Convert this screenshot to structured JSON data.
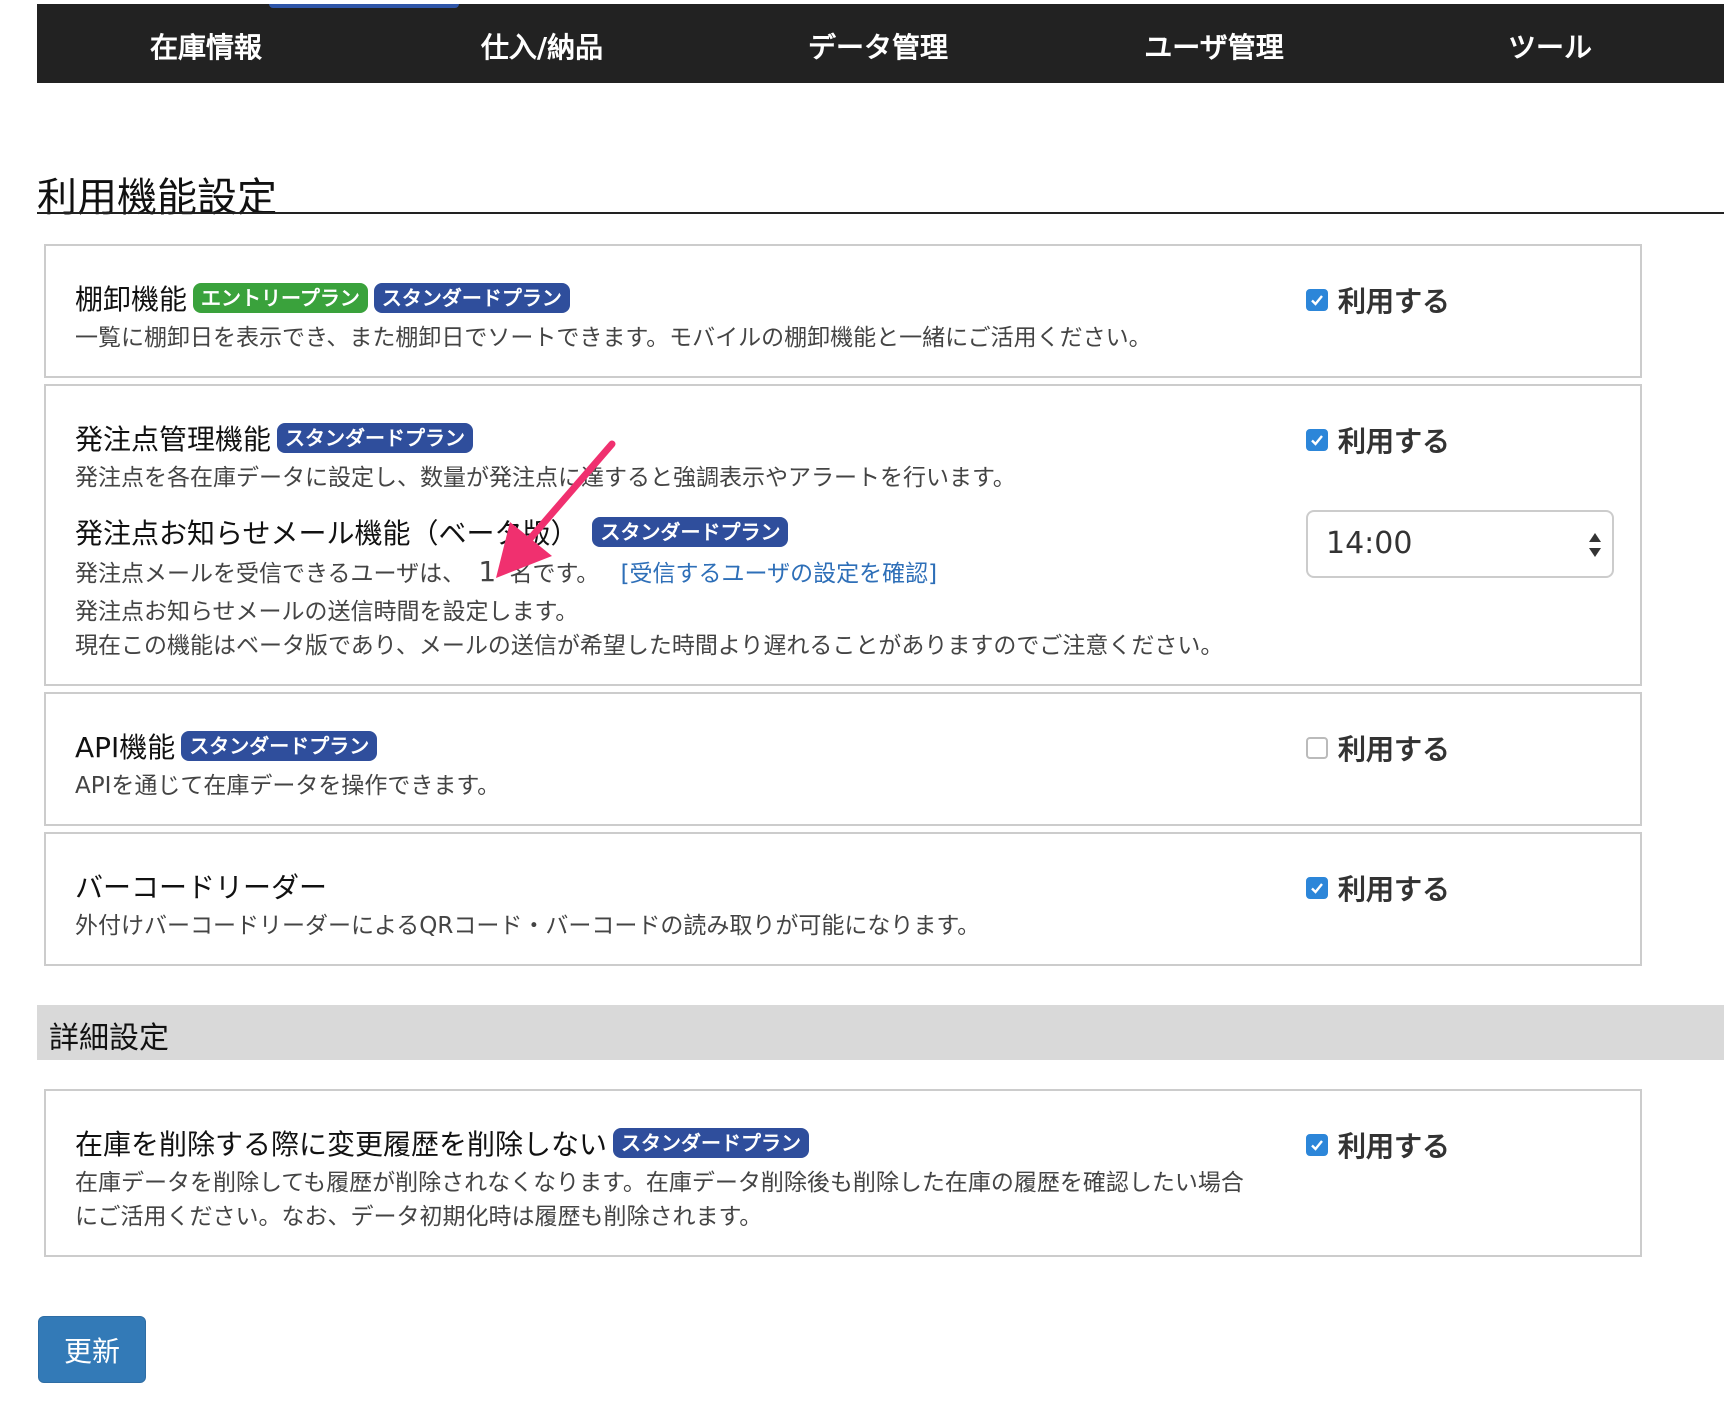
{
  "nav": {
    "items": [
      "在庫情報",
      "仕入/納品",
      "データ管理",
      "ユーザ管理",
      "ツール"
    ]
  },
  "page": {
    "title": "利用機能設定"
  },
  "features": [
    {
      "title": "棚卸機能",
      "badges": [
        "エントリープラン",
        "スタンダードプラン"
      ],
      "description": "一覧に棚卸日を表示でき、また棚卸日でソートできます。モバイルの棚卸機能と一緒にご活用ください。",
      "use_label": "利用する",
      "checked": true
    },
    {
      "title": "発注点管理機能",
      "badges": [
        "スタンダードプラン"
      ],
      "description": "発注点を各在庫データに設定し、数量が発注点に達すると強調表示やアラートを行います。",
      "use_label": "利用する",
      "checked": true,
      "sub": {
        "title": "発注点お知らせメール機能（ベータ版）",
        "badge": "スタンダードプラン",
        "line1_prefix": "発注点メールを受信できるユーザは、",
        "user_count": "1",
        "line1_suffix": "名です。",
        "link": "[受信するユーザの設定を確認]",
        "line2": "発注点お知らせメールの送信時間を設定します。",
        "line3": "現在この機能はベータ版であり、メールの送信が希望した時間より遅れることがありますのでご注意ください。",
        "time_value": "14:00"
      }
    },
    {
      "title": "API機能",
      "badges": [
        "スタンダードプラン"
      ],
      "description": "APIを通じて在庫データを操作できます。",
      "use_label": "利用する",
      "checked": false
    },
    {
      "title": "バーコードリーダー",
      "badges": [],
      "description": "外付けバーコードリーダーによるQRコード・バーコードの読み取りが可能になります。",
      "use_label": "利用する",
      "checked": true
    }
  ],
  "detail": {
    "section_title": "詳細設定",
    "item": {
      "title": "在庫を削除する際に変更履歴を削除しない",
      "badge": "スタンダードプラン",
      "description_line1": "在庫データを削除しても履歴が削除されなくなります。在庫データ削除後も削除した在庫の履歴を確認したい場合",
      "description_line2": "にご活用ください。なお、データ初期化時は履歴も削除されます。",
      "use_label": "利用する",
      "checked": true
    }
  },
  "actions": {
    "update_label": "更新"
  },
  "colors": {
    "navbar": "#222222",
    "badge_entry": "#3aa23c",
    "badge_standard": "#2f4e9c",
    "checkbox_checked": "#2c86d9",
    "button_primary": "#337ab7",
    "link": "#2e6fb8",
    "annotation_arrow": "#f0306f"
  }
}
